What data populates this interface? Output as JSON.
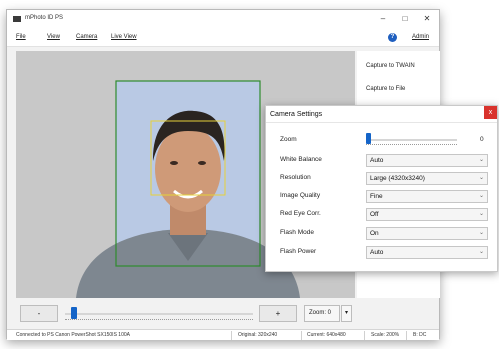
{
  "window": {
    "title": "mPhoto ID PS"
  },
  "title_controls": {
    "minimize": "–",
    "maximize": "□",
    "close": "✕"
  },
  "menu": {
    "items": [
      "File",
      "View",
      "Camera",
      "Live View"
    ],
    "help": "?",
    "admin": "Admin"
  },
  "sidebar": {
    "buttons": [
      "Capture to TWAIN",
      "Capture to File"
    ]
  },
  "controls": {
    "minus": "-",
    "plus": "+",
    "zoom_value": "Zoom: 0",
    "zoom_arrow": "▾",
    "slider_level": 0.05
  },
  "status": {
    "connection": "Connected to PS Canon PowerShot SX150IS 100A",
    "original": "Original: 320x240",
    "current": "Current: 640x480",
    "scale": "Scale: 200%",
    "mode": "B: DC"
  },
  "dialog": {
    "title": "Camera Settings",
    "close": "x",
    "zoom_label": "Zoom",
    "zoom_value": "0",
    "zoom_level": 0.0,
    "settings": [
      {
        "label": "White Balance",
        "value": "Auto"
      },
      {
        "label": "Resolution",
        "value": "Large (4320x3240)"
      },
      {
        "label": "Image Quality",
        "value": "Fine"
      },
      {
        "label": "Red Eye Corr.",
        "value": "Off"
      },
      {
        "label": "Flash Mode",
        "value": "On"
      },
      {
        "label": "Flash Power",
        "value": "Auto"
      }
    ]
  },
  "colors": {
    "face_frame": "#2e8b2e",
    "eye_box": "#e6d13a",
    "accent": "#1464c8",
    "close_red": "#d9332d"
  },
  "icons": {
    "app": "camera-icon",
    "help": "help-icon",
    "caret": "chevron-down-icon"
  }
}
